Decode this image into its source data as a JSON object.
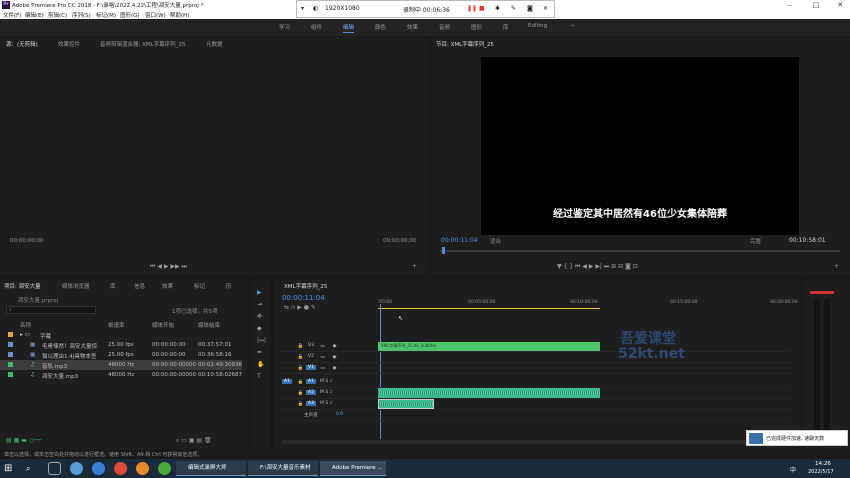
{
  "window": {
    "title": "Adobe Premiere Pro CC 2018 - F:\\录咯\\2022.4.22\\工程\\凋安大量.prproj *",
    "logo": "Pr"
  },
  "menu": [
    "文件(F)",
    "编辑(E)",
    "剪辑(C)",
    "序列(S)",
    "标记(M)",
    "图形(G)",
    "窗口(W)",
    "帮助(H)"
  ],
  "workspaces": [
    "学习",
    "组件",
    "编辑",
    "颜色",
    "效果",
    "音频",
    "图形",
    "库",
    "Editing"
  ],
  "active_workspace": "编辑",
  "recorder": {
    "resolution": "1920X1080",
    "status": "录制中 00:06:36"
  },
  "source_panel": {
    "tabs": [
      "源：(无剪辑)",
      "效果控件",
      "音频剪辑混合器: XML字幕序列_25",
      "元数据"
    ],
    "tc_left": "00;00;00;00",
    "tc_right": "00;00;00;00"
  },
  "program_panel": {
    "title": "节目: XML字幕序列_25",
    "subtitle": "经过鉴定其中居然有46位少女集体陪葬",
    "timecode": "00:00:11:04",
    "fit": "适合",
    "quality": "完整",
    "duration": "00:10:58:01"
  },
  "project_panel": {
    "tabs": [
      "项目: 凋安大量",
      "媒体浏览器",
      "库",
      "信息",
      "效果",
      "标记",
      "历"
    ],
    "file": "凋安大量.prproj",
    "selection": "1项已选择，共5项",
    "search_placeholder": "",
    "columns": [
      "名称",
      "帧速率",
      "媒体开始",
      "媒体结束"
    ],
    "items": [
      {
        "name": "字幕",
        "fps": "",
        "start": "",
        "end": "",
        "color": "#e8a33c"
      },
      {
        "name": "毛骨悚然！凋安大量惊",
        "fps": "25.00 fps",
        "start": "00:00:00:00",
        "end": "00:37:57:01",
        "color": "#6a8fd0"
      },
      {
        "name": "猫以理由1.4J具物本签",
        "fps": "25.00 fps",
        "start": "00:00:00:00",
        "end": "00:36:58:16",
        "color": "#6a8fd0"
      },
      {
        "name": "音轨.mp3",
        "fps": "48000 Hz",
        "start": "00:00:00:00000",
        "end": "00:02:49:30936",
        "color": "#3fb86a"
      },
      {
        "name": "凋安大量.mp3",
        "fps": "48000 Hz",
        "start": "00:00:00:00000",
        "end": "00:10:58:02687",
        "color": "#3fb86a"
      }
    ]
  },
  "timeline": {
    "sequence": "XML字幕序列_25",
    "timecode": "00:00:11:04",
    "ruler": [
      "00:00",
      "00:05:00:00",
      "00:10:00:00",
      "00:15:00:00",
      "00:20:00:00"
    ],
    "tracks": [
      {
        "id": "V3",
        "type": "video"
      },
      {
        "id": "V2",
        "type": "video"
      },
      {
        "id": "V1",
        "type": "video"
      },
      {
        "id": "A1",
        "type": "audio"
      },
      {
        "id": "A2",
        "type": "audio"
      },
      {
        "id": "A3",
        "type": "audio"
      }
    ],
    "master": "主声道",
    "master_val": "0.0",
    "clip_sub": "XML字幕序列_25.dk_Subtitle"
  },
  "watermark": {
    "line1": "吾爱课堂",
    "line2": "52kt.net"
  },
  "status": {
    "text": "单击以选择，或单击空白处并拖动以进行框选。使用 Shift、Alt 和 Ctrl 可获得其他选项。"
  },
  "notification": {
    "text": "已完成硬件加速, 速聊天数"
  },
  "taskbar": {
    "apps": [
      "编辑式录屏大师",
      "F:\\凋安大量音乐素材",
      "Adobe Premiere ..."
    ],
    "time": "14:26",
    "date": "2022/5/17",
    "lang": "中"
  },
  "colors": {
    "accent": "#4a90e2",
    "clip_video": "#4cc46c",
    "clip_audio": "#3bb88f",
    "playhead": "#5a8de0"
  }
}
